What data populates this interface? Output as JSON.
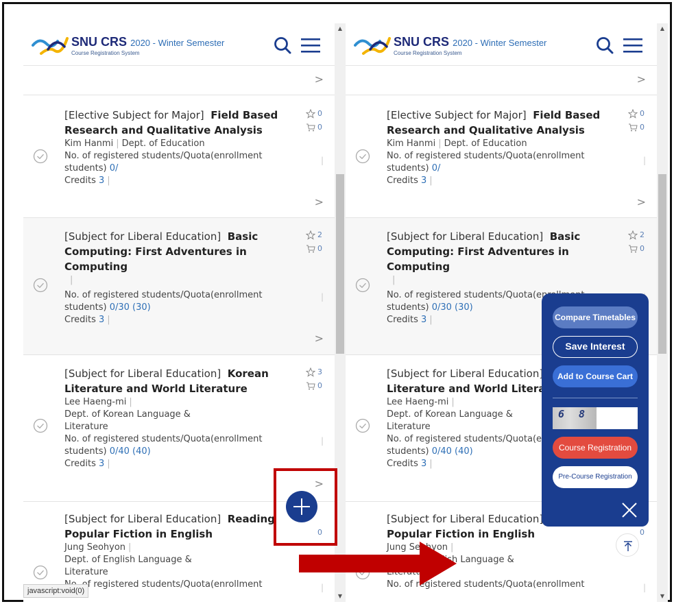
{
  "header": {
    "brand": "SNU CRS",
    "semester": "2020 - Winter Semester",
    "subtitle": "Course Registration System",
    "logo_icon": "snu-crs-logo",
    "search_icon": "search-icon",
    "menu_icon": "hamburger-menu-icon"
  },
  "courses": [
    {
      "category": "[Elective Subject for Major]",
      "name": "Field Based Research and Qualitative Analysis",
      "professor": "Kim Hanmi",
      "dept": "Dept. of Education",
      "reg_label": "No. of registered students/Quota(enrollment students)",
      "reg_value": "0/",
      "reg_quota": "",
      "credits_label": "Credits",
      "credits": "3",
      "interest_count": "0",
      "cart_count": "0"
    },
    {
      "category": "[Subject for Liberal Education]",
      "name": "Basic Computing: First Adventures in Computing",
      "professor": "",
      "dept": "",
      "reg_label": "No. of registered students/Quota(enrollment students)",
      "reg_value": "0/30",
      "reg_quota": "(30)",
      "credits_label": "Credits",
      "credits": "3",
      "interest_count": "2",
      "cart_count": "0"
    },
    {
      "category": "[Subject for Liberal Education]",
      "name": "Korean Literature and World Literature",
      "professor": "Lee Haeng-mi",
      "dept": "Dept. of Korean Language & Literature",
      "reg_label": "No. of registered students/Quota(enrollment students)",
      "reg_value": "0/40",
      "reg_quota": "(40)",
      "credits_label": "Credits",
      "credits": "3",
      "interest_count": "3",
      "cart_count": "0"
    },
    {
      "category": "[Subject for Liberal Education]",
      "name": "Reading Popular Fiction in English",
      "professor": "Jung Seohyon",
      "dept": "Dept. of English Language & Literature",
      "reg_label": "No. of registered students/Quota(enrollment",
      "cart_count": "0"
    }
  ],
  "action_panel": {
    "compare": "Compare Timetables",
    "save": "Save Interest",
    "cart": "Add to Course Cart",
    "captcha": "6 8",
    "register": "Course Registration",
    "pre_register": "Pre-Course Registration",
    "close_icon": "close-icon"
  },
  "status_bar": "javascript:void(0)",
  "colors": {
    "navy": "#1a3d8f",
    "brand_blue": "#1e2a78",
    "link_blue": "#2e6fb6",
    "register_red": "#e34b3f",
    "highlight_red": "#c00000"
  }
}
